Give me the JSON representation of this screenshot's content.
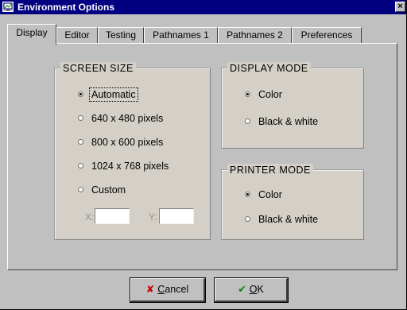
{
  "window": {
    "title": "Environment Options",
    "icon": "app-icon",
    "close_glyph": "×"
  },
  "tabs": [
    {
      "label": "Display",
      "active": true
    },
    {
      "label": "Editor",
      "active": false
    },
    {
      "label": "Testing",
      "active": false
    },
    {
      "label": "Pathnames 1",
      "active": false
    },
    {
      "label": "Pathnames 2",
      "active": false
    },
    {
      "label": "Preferences",
      "active": false
    }
  ],
  "screen_size": {
    "title": "SCREEN SIZE",
    "options": [
      {
        "label": "Automatic",
        "checked": true
      },
      {
        "label": "640 x 480 pixels",
        "checked": false
      },
      {
        "label": "800 x 600 pixels",
        "checked": false
      },
      {
        "label": "1024 x 768 pixels",
        "checked": false
      },
      {
        "label": "Custom",
        "checked": false
      }
    ],
    "x_label": "X:",
    "x_value": "",
    "y_label": "Y:",
    "y_value": ""
  },
  "display_mode": {
    "title": "DISPLAY MODE",
    "options": [
      {
        "label": "Color",
        "checked": true
      },
      {
        "label": "Black & white",
        "checked": false
      }
    ]
  },
  "printer_mode": {
    "title": "PRINTER MODE",
    "options": [
      {
        "label": "Color",
        "checked": true
      },
      {
        "label": "Black & white",
        "checked": false
      }
    ]
  },
  "buttons": {
    "cancel_mnemonic": "C",
    "cancel_rest": "ancel",
    "cancel_icon": "✘",
    "ok_mnemonic": "O",
    "ok_rest": "K",
    "ok_icon": "✔"
  },
  "colors": {
    "titlebar": "#000080",
    "face": "#c0c0c0",
    "group": "#d4d0c8"
  }
}
